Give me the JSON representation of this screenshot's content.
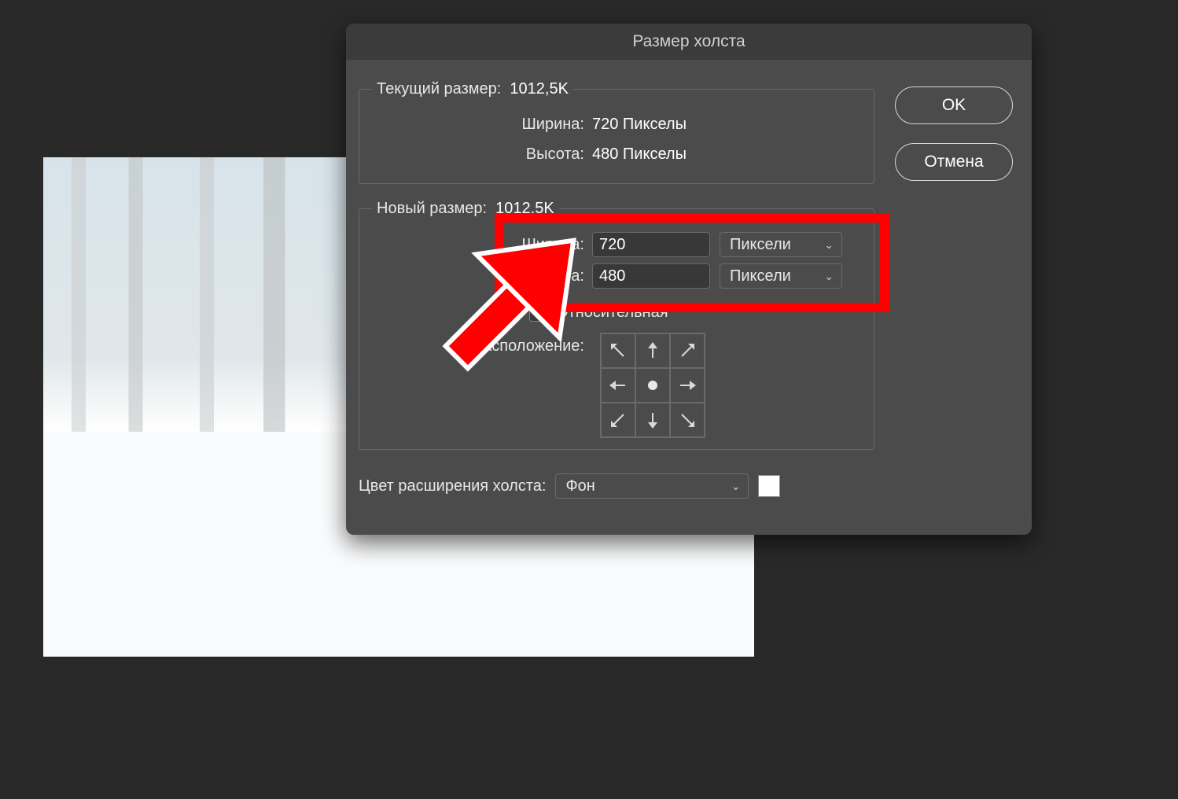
{
  "dialog": {
    "title": "Размер холста",
    "current": {
      "legend_label": "Текущий размер:",
      "legend_value": "1012,5K",
      "width_label": "Ширина:",
      "width_value": "720 Пикселы",
      "height_label": "Высота:",
      "height_value": "480 Пикселы"
    },
    "new": {
      "legend_label": "Новый размер:",
      "legend_value": "1012,5K",
      "width_label": "Ширина:",
      "width_value": "720",
      "width_unit": "Пиксели",
      "height_label": "Высота:",
      "height_value": "480",
      "height_unit": "Пиксели",
      "relative_label": "Относительная",
      "anchor_label": "Расположение:"
    },
    "ext": {
      "label": "Цвет расширения холста:",
      "value": "Фон"
    },
    "buttons": {
      "ok": "OK",
      "cancel": "Отмена"
    }
  }
}
